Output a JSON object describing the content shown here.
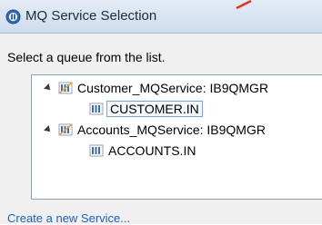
{
  "window": {
    "title": "MQ Service Selection"
  },
  "prompt": "Select a queue from the list.",
  "tree": [
    {
      "label": "Customer_MQService: IB9QMGR",
      "expanded": true,
      "icon": "queue-service-icon",
      "children": [
        {
          "label": "CUSTOMER.IN",
          "selected": true,
          "icon": "queue-icon"
        }
      ]
    },
    {
      "label": "Accounts_MQService: IB9QMGR",
      "expanded": true,
      "icon": "queue-service-icon",
      "children": [
        {
          "label": "ACCOUNTS.IN",
          "selected": false,
          "icon": "queue-icon"
        }
      ]
    }
  ],
  "footer": {
    "create_link": "Create a new Service..."
  },
  "colors": {
    "link": "#1a62b8",
    "annotation_arrow": "#e53222"
  }
}
